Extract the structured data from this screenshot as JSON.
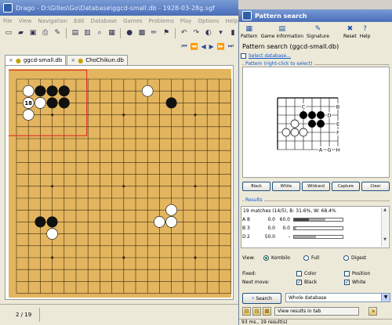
{
  "main_window": {
    "title": "Drago - D:\\Gilles\\Go\\Database\\ggcd-small.db - 1928-03-28g.sgf",
    "menu": [
      "File",
      "View",
      "Navigation",
      "Edit",
      "Database",
      "Games",
      "Problems",
      "Play",
      "Options",
      "Help"
    ],
    "tabs": [
      {
        "label": "ggcd-small.db",
        "active": true
      },
      {
        "label": "ChoChikun.db",
        "active": false
      }
    ],
    "board": {
      "size": 19,
      "black_stones": [
        [
          2,
          1
        ],
        [
          3,
          1
        ],
        [
          4,
          1
        ],
        [
          3,
          2
        ],
        [
          4,
          2
        ],
        [
          13,
          2
        ],
        [
          2,
          12
        ],
        [
          3,
          12
        ]
      ],
      "white_stones": [
        [
          1,
          1
        ],
        [
          2,
          2
        ],
        [
          1,
          3
        ],
        [
          11,
          1
        ],
        [
          13,
          11
        ],
        [
          12,
          12
        ],
        [
          13,
          12
        ],
        [
          3,
          13
        ]
      ],
      "annotated_stone": {
        "col": 1,
        "row": 2,
        "label": "18"
      },
      "selection_region": {
        "from": [
          0,
          0
        ],
        "to": [
          5,
          3
        ],
        "color": "#e02020"
      }
    },
    "status": {
      "move": "2 / 19"
    }
  },
  "pattern_window": {
    "title": "Pattern search",
    "toolbar": [
      "Pattern",
      "Game information",
      "Signature",
      "Reset",
      "Help"
    ],
    "database_label": "Pattern search (ggcd-small.db)",
    "select_database": "Select database...",
    "pattern_section": "Pattern (right-click to select)",
    "pattern_letters": [
      {
        "label": "C"
      },
      {
        "label": "B"
      },
      {
        "label": "D"
      },
      {
        "label": "E"
      },
      {
        "label": "F"
      },
      {
        "label": "A"
      },
      {
        "label": "G"
      },
      {
        "label": "H"
      }
    ],
    "buttons": [
      "Black",
      "White",
      "Wildcard",
      "Capture",
      "Clear"
    ],
    "results_section": "Results",
    "results": {
      "summary": "19 matches (14/5), B: 31.6%, W: 68.4%",
      "rows": [
        {
          "letter": "A",
          "count": "8",
          "black": "0.0",
          "white": "60.0",
          "bar_black": 0.3,
          "bar_gray": 0.35
        },
        {
          "letter": "B",
          "count": "3",
          "black": "0.0",
          "white": "0.0",
          "bar_black": 0.0,
          "bar_gray": 0.05
        },
        {
          "letter": "D",
          "count": "2",
          "black": "50.0",
          "white": "-",
          "bar_black": 0.0,
          "bar_gray": 0.45
        }
      ]
    },
    "view": {
      "label": "View:",
      "options": [
        "Kombilo",
        "Full",
        "Digest"
      ],
      "selected": "Kombilo"
    },
    "fixed": {
      "label": "Fixed:",
      "color": "Color",
      "position": "Position"
    },
    "next_move": {
      "label": "Next move:",
      "black": "Black",
      "white": "White"
    },
    "search_button": "Search",
    "database_select": "Whole database",
    "view_in_tab": "View results in tab",
    "status": "93 ms., 19 result(s)"
  }
}
